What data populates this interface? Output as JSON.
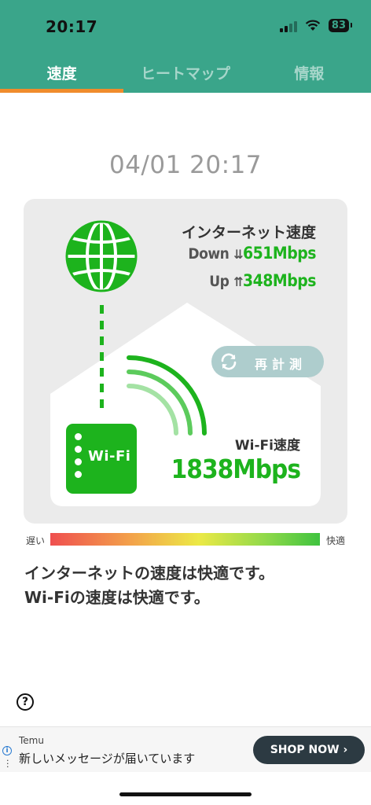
{
  "status_bar": {
    "time": "20:17",
    "battery": "83"
  },
  "tabs": [
    {
      "label": "速度",
      "active": true
    },
    {
      "label": "ヒートマップ",
      "active": false
    },
    {
      "label": "情報",
      "active": false
    }
  ],
  "measured_at": "04/01 20:17",
  "internet": {
    "title": "インターネット速度",
    "down_label": "Down",
    "down_arrows": "⇊",
    "down_value": "651Mbps",
    "up_label": "Up",
    "up_arrows": "⇈",
    "up_value": "348Mbps"
  },
  "remeasure_label": "再計測",
  "router_label": "Wi-Fi",
  "wifi": {
    "title": "Wi-Fi速度",
    "value": "1838Mbps"
  },
  "scale": {
    "slow": "遅い",
    "fast": "快適"
  },
  "message": {
    "line1": "インターネットの速度は快適です。",
    "line2": "Wi-Fiの速度は快適です。"
  },
  "help_label": "?",
  "ad": {
    "brand": "Temu",
    "text": "新しいメッセージが届いています",
    "button": "SHOP NOW ›"
  },
  "colors": {
    "header": "#3aa58a",
    "accent_underline": "#f08c2c",
    "speed_green": "#1db31d",
    "card_bg": "#ebebeb",
    "remeasure_bg": "#aecdcd"
  },
  "icons": [
    "globe-icon",
    "refresh-icon",
    "wifi-waves-icon",
    "help-icon",
    "ad-info-icon"
  ]
}
